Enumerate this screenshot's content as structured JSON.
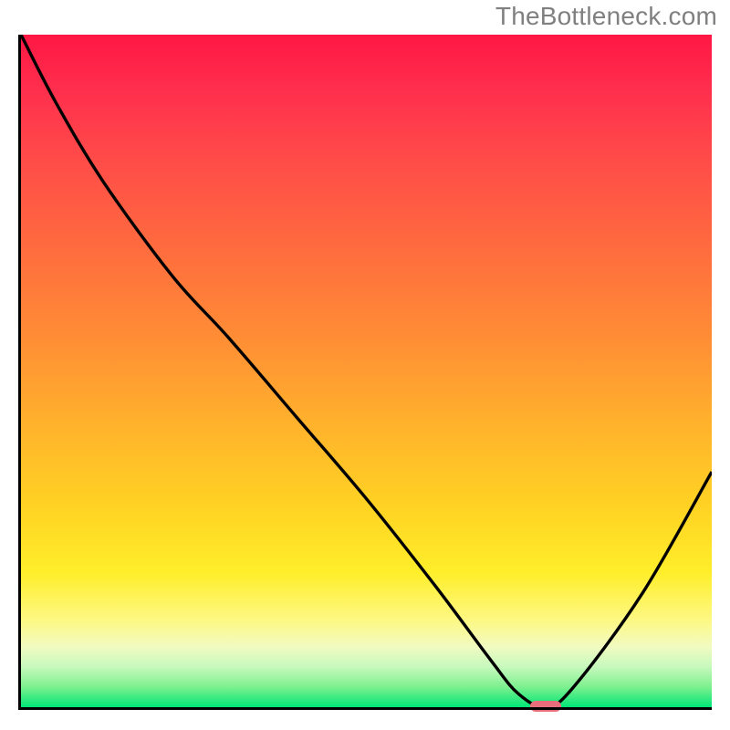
{
  "watermark": "TheBottleneck.com",
  "chart_data": {
    "type": "line",
    "x": [
      0,
      0.05,
      0.12,
      0.22,
      0.3,
      0.4,
      0.5,
      0.6,
      0.68,
      0.72,
      0.76,
      0.8,
      0.9,
      1.0
    ],
    "series": [
      {
        "name": "bottleneck-curve",
        "values": [
          100,
          90,
          78,
          64,
          55,
          43,
          31,
          18,
          7,
          2,
          0,
          3,
          17,
          35
        ]
      }
    ],
    "minimum_marker": {
      "x": 0.76,
      "y": 0
    },
    "xlim": [
      0,
      1
    ],
    "ylim": [
      0,
      100
    ],
    "xlabel": "",
    "ylabel": "",
    "title": "",
    "legend": false,
    "grid": false,
    "background": "red-to-green vertical gradient"
  },
  "colors": {
    "curve": "#000000",
    "marker": "#e96d7a",
    "watermark": "#808080"
  }
}
